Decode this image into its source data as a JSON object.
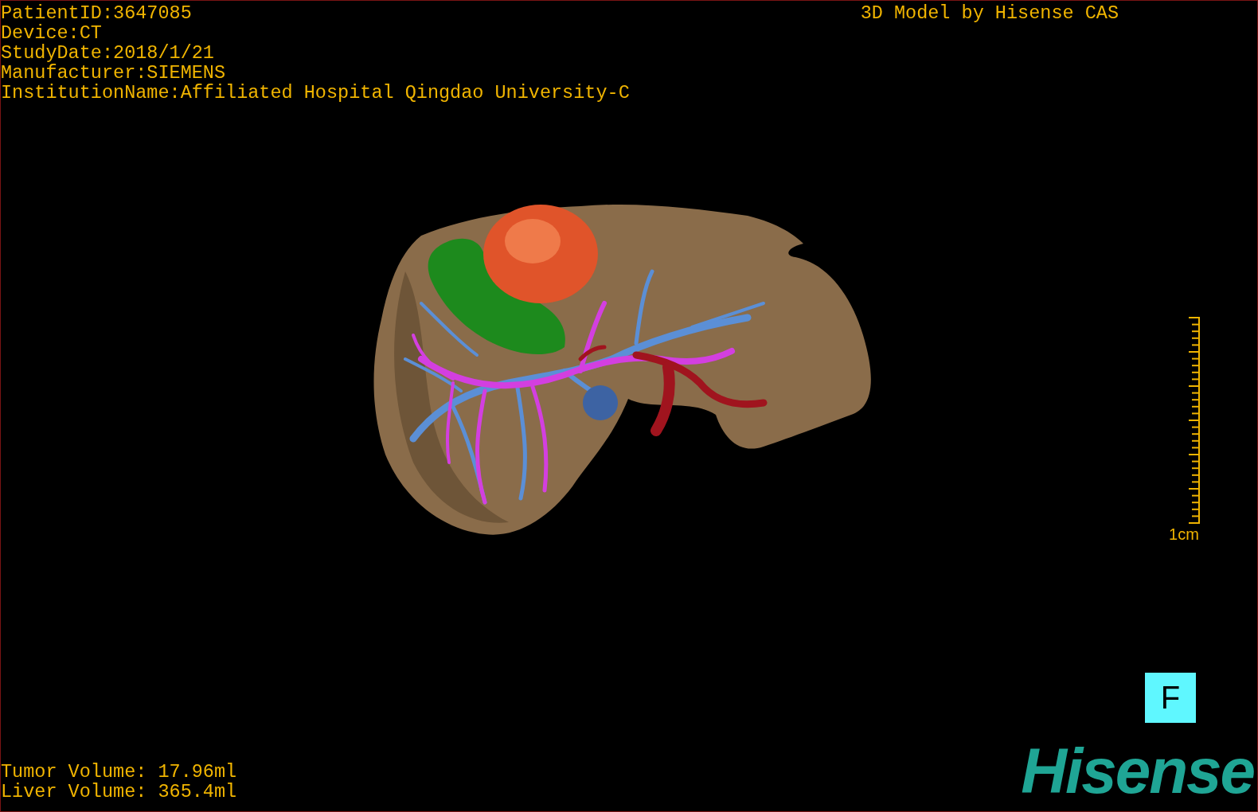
{
  "info_lines": [
    "PatientID:3647085",
    "Device:CT",
    "StudyDate:2018/1/21",
    "Manufacturer:SIEMENS",
    "InstitutionName:Affiliated Hospital Qingdao University-C"
  ],
  "caption": "3D Model by Hisense CAS",
  "scale_bar": {
    "label": "1cm"
  },
  "orientation_label": "F",
  "volumes": [
    "Tumor Volume: 17.96ml",
    "Liver Volume: 365.4ml"
  ],
  "logo": "Hisense"
}
